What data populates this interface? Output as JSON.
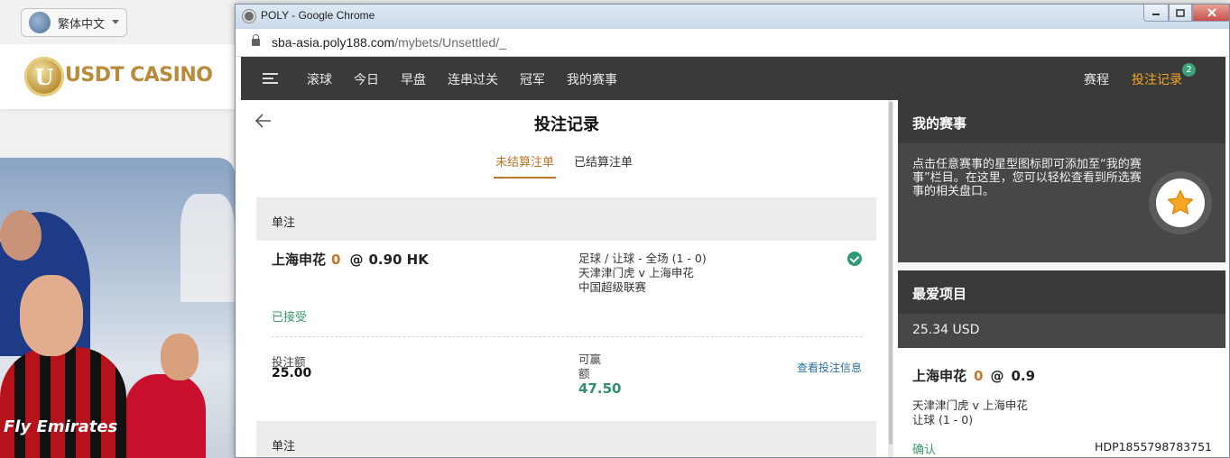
{
  "background_page": {
    "language": "繁体中文",
    "logo_badge": "U",
    "logo_text": "USDT CASINO",
    "promo_sponsor": "Fly Emirates"
  },
  "window": {
    "title": "POLY - Google Chrome",
    "url_host": "sba-asia.poly188.com",
    "url_path": "/mybets/Unsettled/_"
  },
  "nav": {
    "items": [
      "滚球",
      "今日",
      "早盘",
      "连串过关",
      "冠军",
      "我的赛事"
    ],
    "schedule": "赛程",
    "records": "投注记录",
    "records_badge": "2",
    "accent_color": "#f5a623"
  },
  "main": {
    "title": "投注记录",
    "tabs": [
      "未结算注单",
      "已结算注单"
    ],
    "bets": [
      {
        "type": "单注",
        "selection": "上海申花",
        "handicap": "0",
        "at": "@",
        "odds": "0.90 HK",
        "market": "足球 / 让球 - 全场 (1 - 0)",
        "match": "天津津门虎 v 上海申花",
        "league": "中国超级联赛",
        "status": "已接受",
        "stake_label": "投注额",
        "stake": "25.00",
        "win_label": "可赢额",
        "win": "47.50",
        "detail_link": "查看投注信息"
      },
      {
        "type": "单注"
      }
    ]
  },
  "sidebar": {
    "my_events_title": "我的赛事",
    "my_events_text": "点击任意赛事的星型图标即可添加至“我的赛事”栏目。在这里，您可以轻松查看到所选赛事的相关盘口。",
    "favorites_title": "最爱项目",
    "favorites_amount": "25.34 USD",
    "fav": {
      "selection": "上海申花",
      "handicap": "0",
      "at": "@",
      "odds": "0.9",
      "match": "天津津门虎 v 上海申花",
      "market": "让球 (1 - 0)",
      "status": "确认",
      "ref": "HDP1855798783751"
    }
  }
}
